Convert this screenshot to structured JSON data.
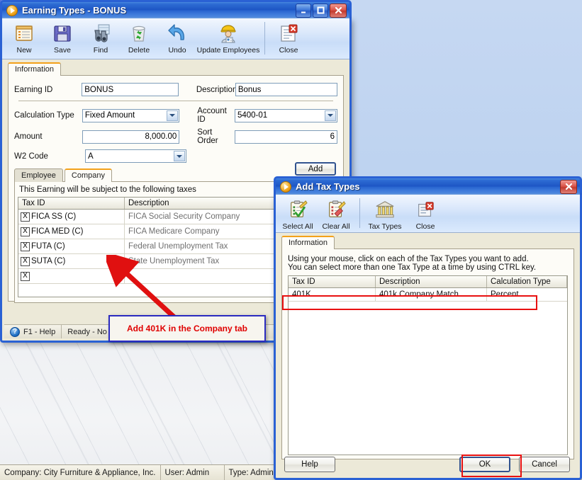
{
  "main_window": {
    "title": "Earning Types  -  BONUS",
    "title_icon": "play-circle-icon",
    "window_buttons": [
      "minimize",
      "maximize",
      "close"
    ],
    "toolbar": [
      {
        "label": "New",
        "icon": "new-document-icon"
      },
      {
        "label": "Save",
        "icon": "floppy-disk-icon"
      },
      {
        "label": "Find",
        "icon": "binoculars-icon"
      },
      {
        "label": "Delete",
        "icon": "recycle-bin-icon"
      },
      {
        "label": "Undo",
        "icon": "undo-arrow-icon"
      },
      {
        "label": "Update Employees",
        "icon": "worker-badge-icon"
      },
      {
        "label": "Close",
        "icon": "document-close-icon"
      }
    ],
    "tabs": [
      {
        "label": "Information",
        "active": true
      }
    ],
    "form": {
      "earning_id_label": "Earning ID",
      "earning_id_value": "BONUS",
      "description_label": "Description",
      "description_value": "Bonus",
      "calculation_type_label": "Calculation Type",
      "calculation_type_value": "Fixed Amount",
      "account_id_label": "Account ID",
      "account_id_value": "5400-01",
      "amount_label": "Amount",
      "amount_value": "8,000.00",
      "sort_order_label": "Sort Order",
      "sort_order_value": "6",
      "w2_code_label": "W2 Code",
      "w2_code_value": "A"
    },
    "add_button_label": "Add",
    "sub_tabs": [
      {
        "label": "Employee",
        "active": false
      },
      {
        "label": "Company",
        "active": true
      }
    ],
    "taxes_caption": "This Earning will be subject to the following taxes",
    "taxes_grid": {
      "columns": [
        "Tax ID",
        "Description"
      ],
      "rows": [
        {
          "check": "X",
          "tax_id": "FICA SS (C)",
          "description": "FICA Social Security Company"
        },
        {
          "check": "X",
          "tax_id": "FICA MED (C)",
          "description": "FICA Medicare Company"
        },
        {
          "check": "X",
          "tax_id": "FUTA (C)",
          "description": "Federal Unemployment Tax"
        },
        {
          "check": "X",
          "tax_id": "SUTA (C)",
          "description": "State Unemployment Tax"
        },
        {
          "check": "X",
          "tax_id": "",
          "description": ""
        }
      ]
    },
    "status_bar": {
      "help": "F1 - Help",
      "ready": "Ready - No m"
    }
  },
  "dialog": {
    "title": "Add Tax Types",
    "title_icon": "play-circle-icon",
    "close_button": "close",
    "toolbar": [
      {
        "label": "Select All",
        "icon": "clipboard-check-icon"
      },
      {
        "label": "Clear All",
        "icon": "clipboard-erase-icon"
      },
      {
        "label": "Tax Types",
        "icon": "bank-building-icon"
      },
      {
        "label": "Close",
        "icon": "document-close-icon"
      }
    ],
    "tabs": [
      {
        "label": "Information",
        "active": true
      }
    ],
    "instructions_line1": "Using your mouse, click on each of the Tax Types you want to add.",
    "instructions_line2": "You can select more than one Tax Type at a time by using CTRL key.",
    "grid": {
      "columns": [
        "Tax ID",
        "Description",
        "Calculation Type"
      ],
      "rows": [
        {
          "tax_id": "401K",
          "description": "401k Company Match",
          "calculation_type": "Percent"
        }
      ]
    },
    "buttons": {
      "help": "Help",
      "ok": "OK",
      "cancel": "Cancel"
    }
  },
  "annotation": {
    "callout_text": "Add 401K in the Company tab",
    "callout_color": "#e00000",
    "arrow_color": "#e01010",
    "highlight_color": "#e81010"
  },
  "os_status_bar": {
    "company": "Company: City Furniture & Appliance, Inc.",
    "user": "User: Admin",
    "type": "Type: Administrat"
  }
}
